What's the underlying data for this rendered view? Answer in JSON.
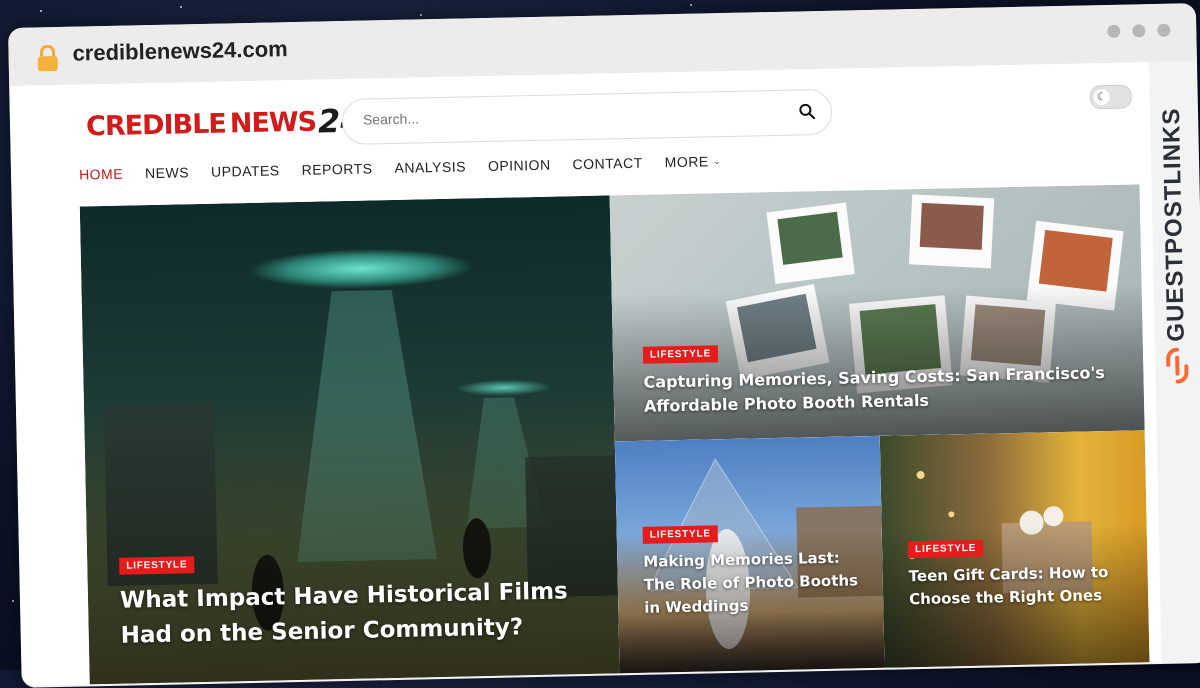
{
  "browser": {
    "url": "crediblenews24.com"
  },
  "side_brand": {
    "text": "GUESTPOSTLINKS"
  },
  "site": {
    "logo": {
      "part1": "CREDIBLE",
      "part2": "NEWS",
      "part3": "24"
    },
    "search": {
      "placeholder": "Search..."
    },
    "nav": [
      {
        "label": "HOME",
        "active": true
      },
      {
        "label": "NEWS"
      },
      {
        "label": "UPDATES"
      },
      {
        "label": "REPORTS"
      },
      {
        "label": "ANALYSIS"
      },
      {
        "label": "OPINION"
      },
      {
        "label": "CONTACT"
      },
      {
        "label": "MORE"
      }
    ]
  },
  "articles": [
    {
      "category": "LIFESTYLE",
      "title": "What Impact Have Historical Films Had on the Senior Community?"
    },
    {
      "category": "LIFESTYLE",
      "title": "Capturing Memories, Saving Costs: San Francisco's Affordable Photo Booth Rentals"
    },
    {
      "category": "LIFESTYLE",
      "title": "Making Memories Last: The Role of Photo Booths in Weddings"
    },
    {
      "category": "LIFESTYLE",
      "title": "Teen Gift Cards: How to Choose the Right Ones"
    }
  ],
  "colors": {
    "accent": "#e41c1c",
    "nav_active": "#c21a1a"
  }
}
